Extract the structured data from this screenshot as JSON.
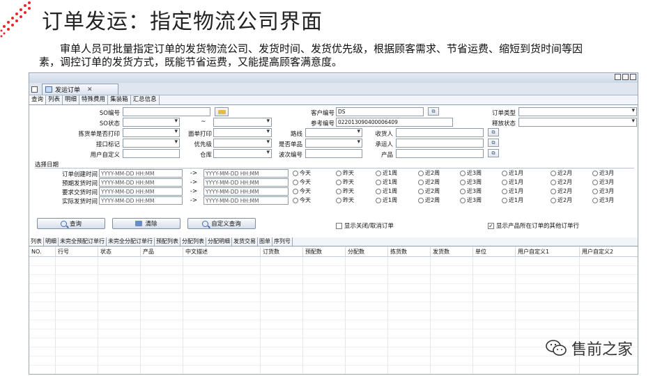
{
  "slide": {
    "title": "订单发运：指定物流公司界面",
    "description": "审单人员可批量指定订单的发货物流公司、发货时间、发货优先级，根据顾客需求、节省运费、缩短到货时间等因素，调控订单的发货方式，既能节省运费，又能提高顾客满意度。",
    "watermark": "售前之家",
    "accent_color": "#e8262b"
  },
  "window": {
    "doc_tab": "发运订单"
  },
  "query_tabs": [
    "查询",
    "列表",
    "明细",
    "特殊费用",
    "集装箱",
    "汇总信息"
  ],
  "form": {
    "so_no_label": "SO编号",
    "so_status_label": "SO状态",
    "pick_print_label": "拣货单是否打印",
    "face_print_label": "面单打印",
    "port_mark_label": "接口标记",
    "priority_label": "优先级",
    "user_def_label": "用户自定义",
    "warehouse_label": "仓库",
    "customer_no_label": "客户编号",
    "customer_no_value": "DS",
    "ref_no_label": "参考编号",
    "ref_no_value": "022013090400006409",
    "route_label": "路线",
    "receiver_label": "收货人",
    "single_item_label": "是否单品",
    "carrier_label": "承运人",
    "wave_no_label": "波次编号",
    "product_label": "产品",
    "order_type_label": "订单类型",
    "release_status_label": "释放状态",
    "tilde": "~"
  },
  "date_section": {
    "title": "选择日期",
    "placeholder": "YYYY-MM-DD HH:MM",
    "arrow": "->",
    "rows": [
      "订单创建时间",
      "预期发货时间",
      "要求交货时间",
      "实际发货时间"
    ],
    "ranges": [
      "今天",
      "昨天",
      "近1周",
      "近2周",
      "近3周",
      "近1月",
      "近2月",
      "近3月"
    ]
  },
  "buttons": {
    "query": "查询",
    "clear": "清除",
    "custom_query": "自定义查询"
  },
  "checkboxes": {
    "show_closed": "显示关闭/取消订单",
    "show_closed_checked": false,
    "show_other_orders": "显示产品所在订单的其他订单行",
    "show_other_orders_checked": true
  },
  "result_tabs": [
    "列表",
    "明细",
    "未完全预配订单行",
    "未完全分配订单行",
    "预配列表",
    "分配列表",
    "分配明细",
    "发货交易",
    "图单",
    "序列号"
  ],
  "grid_columns": [
    "NO.",
    "行号",
    "状态",
    "产品",
    "中文描述",
    "订货数",
    "预配数",
    "分配数",
    "拣货数",
    "发货数",
    "单位",
    "用户自定义1",
    "用户自定义2"
  ]
}
